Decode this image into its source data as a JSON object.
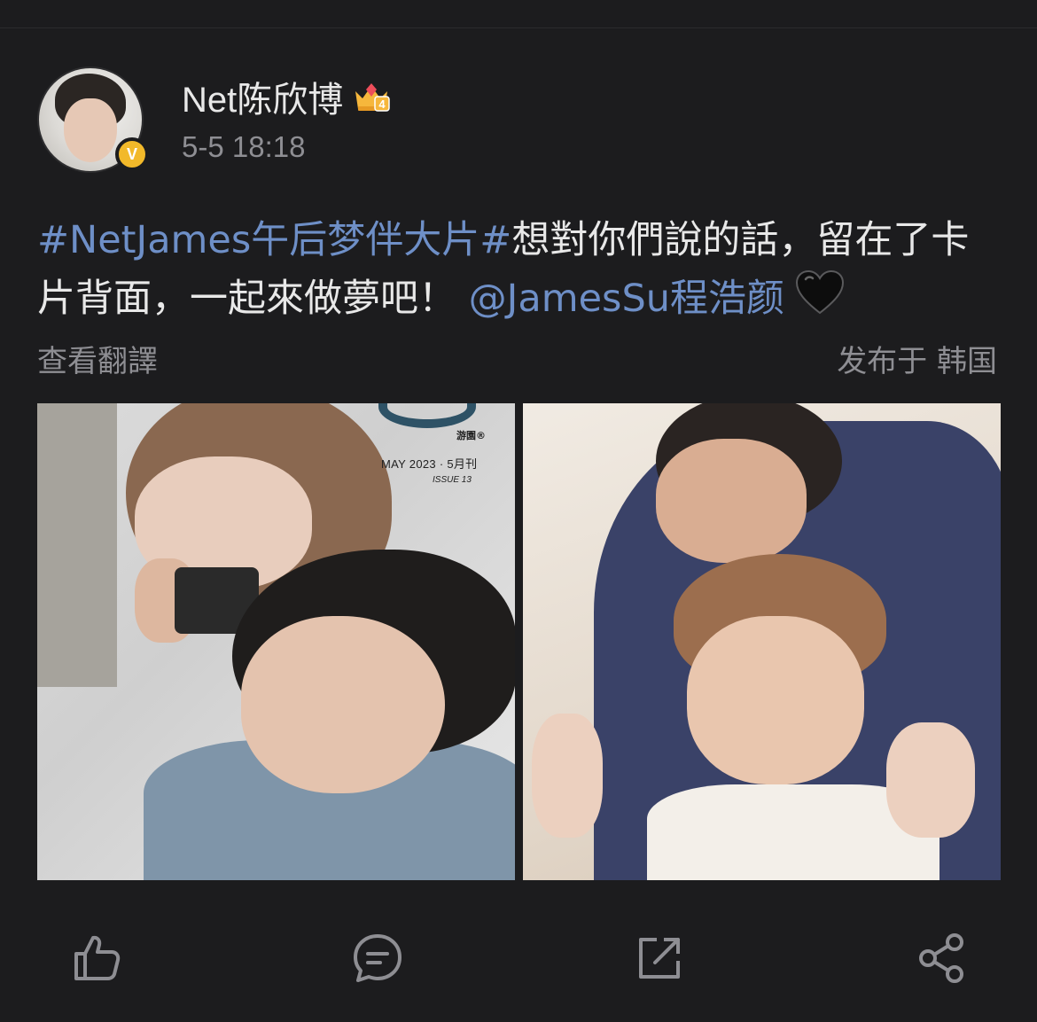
{
  "post": {
    "username": "Net陈欣博",
    "timestamp": "5-5 18:18",
    "text": {
      "tag": "#NetJames午后梦伴大片#",
      "body": "想對你們說的話，留在了卡片背面，一起來做夢吧！",
      "mention": "@JamesSu程浩颜"
    },
    "translate_label": "查看翻譯",
    "location": "发布于 韩国"
  },
  "magazine": {
    "logo": "游園®",
    "date_line": "MAY  2023 · 5月刊",
    "issue": "ISSUE 13"
  },
  "icons": {
    "avatar": "avatar",
    "verified": "verified-badge-icon",
    "crown": "crown-level-icon",
    "heart": "black-heart-icon",
    "like": "thumbs-up-icon",
    "comment": "comment-icon",
    "repost": "repost-icon",
    "share": "share-icon"
  },
  "colors": {
    "background": "#1c1c1e",
    "link": "#6e8fc7",
    "secondary_text": "#8e8e93",
    "verified": "#f2b92a"
  },
  "badges": {
    "crown_level": "4",
    "verified_letter": "V"
  }
}
